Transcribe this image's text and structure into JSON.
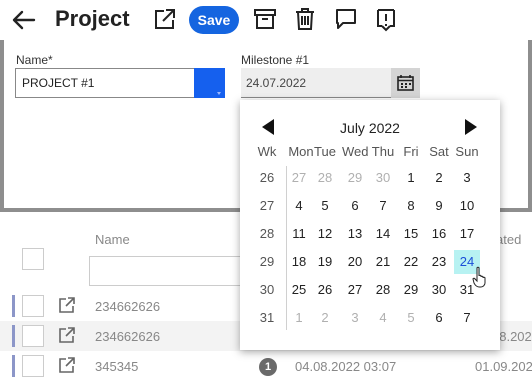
{
  "header": {
    "title": "Project",
    "save_label": "Save",
    "icons": [
      "back-arrow-icon",
      "open-external-icon",
      "archive-icon",
      "delete-icon",
      "comment-icon",
      "history-icon"
    ]
  },
  "form": {
    "name_label": "Name*",
    "name_value": "PROJECT #1",
    "color": "#1560ee",
    "milestone_label": "Milestone #1",
    "milestone_value": "24.07.2022"
  },
  "table": {
    "columns": [
      "Name",
      "ated"
    ],
    "rows": [
      {
        "name": "234662626",
        "badge": "",
        "date1": "",
        "date2": ""
      },
      {
        "name": "234662626",
        "badge": "",
        "date1": "",
        "date2": "08.202"
      },
      {
        "name": "345345",
        "badge": "1",
        "date1": "04.08.2022 03:07",
        "date2": "01.09.202"
      }
    ]
  },
  "calendar": {
    "month_label": "July 2022",
    "headers": [
      "Wk",
      "Mon",
      "Tue",
      "Wed",
      "Thu",
      "Fri",
      "Sat",
      "Sun"
    ],
    "weeks": [
      {
        "wk": "26",
        "days": [
          "27",
          "28",
          "29",
          "30",
          "1",
          "2",
          "3"
        ]
      },
      {
        "wk": "27",
        "days": [
          "4",
          "5",
          "6",
          "7",
          "8",
          "9",
          "10"
        ]
      },
      {
        "wk": "28",
        "days": [
          "11",
          "12",
          "13",
          "14",
          "15",
          "16",
          "17"
        ]
      },
      {
        "wk": "29",
        "days": [
          "18",
          "19",
          "20",
          "21",
          "22",
          "23",
          "24"
        ]
      },
      {
        "wk": "30",
        "days": [
          "25",
          "26",
          "27",
          "28",
          "29",
          "30",
          "31"
        ]
      },
      {
        "wk": "31",
        "days": [
          "1",
          "2",
          "3",
          "4",
          "5",
          "6",
          "7"
        ]
      }
    ],
    "selected_day": "24",
    "selected_color": "#b7f2f2"
  }
}
